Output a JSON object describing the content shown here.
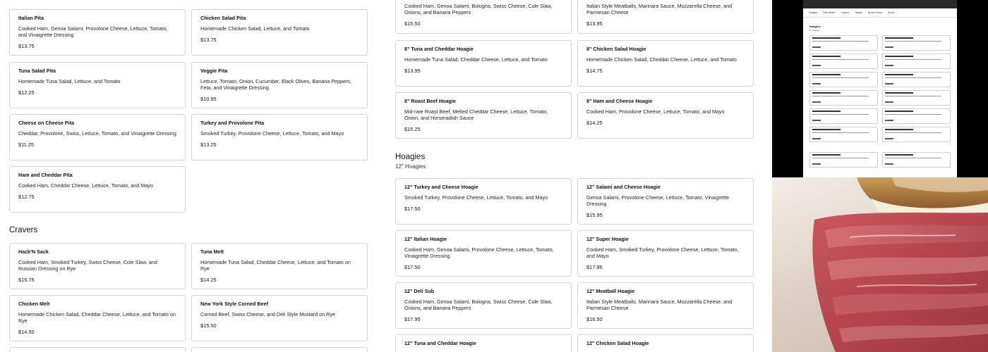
{
  "left_column_cards": [
    {
      "title": "Italian Pita",
      "desc": "Cooked Ham, Genoa Salami, Provolone Cheese, Lettuce, Tomato, and Vinaigrette Dressing",
      "price": "$13.75"
    },
    {
      "title": "Tuna Salad Pita",
      "desc": "Homemade Tuna Salad, Lettuce, and Tomato",
      "price": "$12.25"
    },
    {
      "title": "Cheese on Cheese Pita",
      "desc": "Cheddar, Provolone, Swiss, Lettuce, Tomato, and Vinaigrette Dressing",
      "price": "$11.25"
    },
    {
      "title": "Ham and Cheddar Pita",
      "desc": "Cooked Ham, Cheddar Cheese, Lettuce, Tomato, and Mayo",
      "price": "$12.75"
    }
  ],
  "mid_column_cards": [
    {
      "title": "Chicken Salad Pita",
      "desc": "Homemade Chicken Salad, Lettuce, and Tomato",
      "price": "$13.75"
    },
    {
      "title": "Veggie Pita",
      "desc": "Lettuce, Tomato, Onion, Cucumber, Black Olives, Banana Peppers, Feta, and Vinaigrette Dressing",
      "price": "$10.95"
    },
    {
      "title": "Turkey and Provolone Pita",
      "desc": "Smoked Turkey, Provolone Cheese, Lettuce, Tomato, and Mayo",
      "price": "$13.25"
    }
  ],
  "cravers": {
    "title": "Cravers",
    "cards": [
      {
        "title": "Hack'N Sack",
        "desc": "Cooked Ham, Smoked Turkey, Swiss Cheese, Cole Slaw, and Russian Dressing on Rye",
        "price": "$15.75"
      },
      {
        "title": "Tuna Melt",
        "desc": "Homemade Tuna Salad, Cheddar Cheese, Lettuce, and Tomato on Rye",
        "price": "$14.25"
      },
      {
        "title": "Chicken Melt",
        "desc": "Homemade Chicken Salad, Cheddar Cheese, Lettuce, and Tomato on Rye",
        "price": "$14.50"
      },
      {
        "title": "New York Style Corned Beef",
        "desc": "Corned Beef, Swiss Cheese, and Deli Style Mustard on Rye",
        "price": "$15.50"
      }
    ]
  },
  "eight_inch_cards": [
    {
      "title": "",
      "desc": "Cooked Ham, Genoa Salami, Bologna, Swiss Cheese, Cole Slaw, Onions, and Banana Peppers",
      "price": "$15.50"
    },
    {
      "title": "",
      "desc": "Italian Style Meatballs, Marinara Sauce, Mozzarella Cheese, and Parmesan Cheese",
      "price": "$13.95"
    },
    {
      "title": "8\" Tuna and Cheddar Hoagie",
      "desc": "Homemade Tuna Salad, Cheddar Cheese, Lettuce, and Tomato",
      "price": "$13.95"
    },
    {
      "title": "8\" Chicken Salad Hoagie",
      "desc": "Homemade Chicken Salad, Cheddar Cheese, Lettuce, and Tomato",
      "price": "$14.75"
    },
    {
      "title": "8\" Roast Beef Hoagie",
      "desc": "Mid-rare Roast Beef, Melted Cheddar Cheese, Lettuce, Tomato, Onion, and Horseradish Sauce",
      "price": "$15.25"
    },
    {
      "title": "8\" Ham and Cheese Hoagie",
      "desc": "Cooked Ham, Provolone Cheese, Lettuce, Tomato, and Mayo",
      "price": "$14.25"
    }
  ],
  "hoagies": {
    "title": "Hoagies",
    "subtitle": "12\" Hoagies",
    "cards": [
      {
        "title": "12\" Turkey and Cheese Hoagie",
        "desc": "Smoked Turkey, Provolone Cheese, Lettuce, Tomato, and Mayo",
        "price": "$17.50"
      },
      {
        "title": "12\" Salami and Cheese Hoagie",
        "desc": "Genoa Salami, Provolone Cheese, Lettuce, Tomato, Vinaigrette Dressing",
        "price": "$15.95"
      },
      {
        "title": "12\" Italian Hoagie",
        "desc": "Cooked Ham, Genoa Salami, Provolone Cheese, Lettuce, Tomato, Vinaigrette Dressing",
        "price": "$17.50"
      },
      {
        "title": "12\" Super Hoagie",
        "desc": "Cooked Ham, Smoked Turkey, Provolone Cheese, Lettuce, Tomato, and Mayo",
        "price": "$17.95"
      },
      {
        "title": "12\" Deli Sub",
        "desc": "Cooked Ham, Genoa Salami, Bologna, Swiss Cheese, Cole Slaw, Onions, and Banana Peppers",
        "price": "$17.95"
      },
      {
        "title": "12\" Meatball Hoagie",
        "desc": "Italian Style Meatballs, Marinara Sauce, Mozzarella Cheese, and Parmesan Cheese",
        "price": "$16.50"
      },
      {
        "title": "12\" Tuna and Cheddar Hoagie",
        "desc": "",
        "price": ""
      },
      {
        "title": "12\" Chicken Salad Hoagie",
        "desc": "",
        "price": ""
      }
    ]
  },
  "side_panel": {
    "nav_items": [
      "Hoagies",
      "Pita Delites",
      "Cravers",
      "Salads",
      "By the Pound",
      "Drinks"
    ],
    "section_title": "Hoagies",
    "section_sub": "8\" Hoagies"
  }
}
